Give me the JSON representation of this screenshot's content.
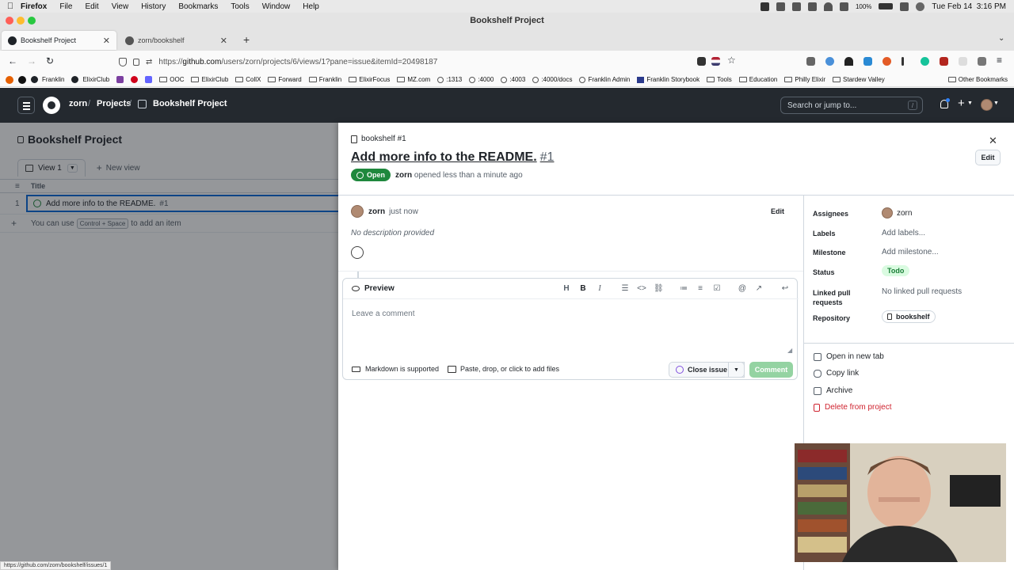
{
  "menubar": {
    "items": [
      "Firefox",
      "File",
      "Edit",
      "View",
      "History",
      "Bookmarks",
      "Tools",
      "Window",
      "Help"
    ],
    "battery": "100%",
    "clock": "Tue Feb 14  3:16 PM"
  },
  "window": {
    "title": "Bookshelf Project"
  },
  "tabs": [
    {
      "label": "Bookshelf Project"
    },
    {
      "label": "zorn/bookshelf"
    }
  ],
  "nav": {
    "url_prefix": "https://",
    "url_host": "github.com",
    "url_path": "/users/zorn/projects/6/views/1?pane=issue&itemId=20498187"
  },
  "bookmarks": [
    "Franklin",
    "ElixirClub",
    "OOC",
    "ElixirClub",
    "CollX",
    "Forward",
    "Franklin",
    "ElixirFocus",
    "MZ.com",
    ":1313",
    ":4000",
    ":4003",
    ":4000/docs",
    "Franklin Admin",
    "Franklin Storybook",
    "Tools",
    "Education",
    "Philly Elixir",
    "Stardew Valley"
  ],
  "bookmarks_other": "Other Bookmarks",
  "gh": {
    "crumb_user": "zorn",
    "crumb_projects": "Projects",
    "crumb_project": "Bookshelf Project",
    "search_placeholder": "Search or jump to...",
    "search_key": "/"
  },
  "project": {
    "title": "Bookshelf Project",
    "view_label": "View 1",
    "new_view": "New view",
    "col_title": "Title",
    "row_num": "1",
    "row_title": "Add more info to the README.",
    "row_issue": "#1",
    "add_prefix": "You can use",
    "add_key": "Control + Space",
    "add_suffix": "to add an item"
  },
  "issue": {
    "repo_ref": "bookshelf #1",
    "title": "Add more info to the README.",
    "number": "#1",
    "edit_label": "Edit",
    "state": "Open",
    "author": "zorn",
    "opened_text": "opened less than a minute ago",
    "comment_author": "zorn",
    "comment_time": "just now",
    "comment_edit": "Edit",
    "no_description": "No description provided",
    "editor_tab": "Preview",
    "comment_placeholder": "Leave a comment",
    "markdown_note": "Markdown is supported",
    "attach_note": "Paste, drop, or click to add files",
    "close_issue": "Close issue",
    "comment_button": "Comment"
  },
  "props": {
    "assignees_label": "Assignees",
    "assignees_value": "zorn",
    "labels_label": "Labels",
    "labels_value": "Add labels...",
    "milestone_label": "Milestone",
    "milestone_value": "Add milestone...",
    "status_label": "Status",
    "status_value": "Todo",
    "linked_label_1": "Linked pull",
    "linked_label_2": "requests",
    "linked_value": "No linked pull requests",
    "repo_label": "Repository",
    "repo_value": "bookshelf"
  },
  "actions": {
    "open_tab": "Open in new tab",
    "copy_link": "Copy link",
    "archive": "Archive",
    "delete": "Delete from project"
  },
  "status_bar_url": "https://github.com/zorn/bookshelf/issues/1",
  "colors": {
    "gh_header": "#24292f",
    "open_green": "#1f883d",
    "status_todo_bg": "#dafbe1",
    "delete_red": "#cf222e",
    "comment_btn": "#94d3a2"
  }
}
